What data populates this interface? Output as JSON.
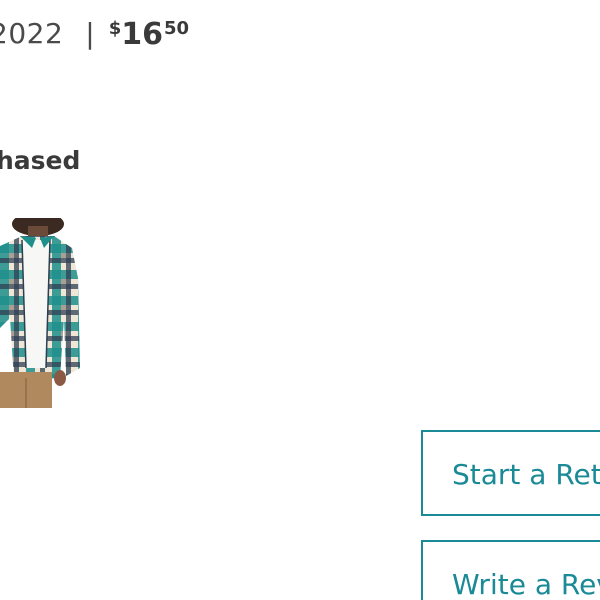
{
  "order": {
    "date_fragment": "2022",
    "divider": "|",
    "price": {
      "currency_symbol": "$",
      "dollars": "16",
      "cents": "50"
    }
  },
  "status": {
    "label": "hased"
  },
  "product": {
    "image_alt": "plaid flannel shirt",
    "colors": {
      "teal": "#1f8f8c",
      "cream": "#efe6d6",
      "navy": "#2d3f52",
      "khaki": "#b08a5e"
    }
  },
  "actions": {
    "start_return_label": "Start a Retu",
    "write_review_label": "Write a Revi"
  },
  "theme": {
    "accent": "#1a8a97",
    "text": "#3a3a3a"
  }
}
